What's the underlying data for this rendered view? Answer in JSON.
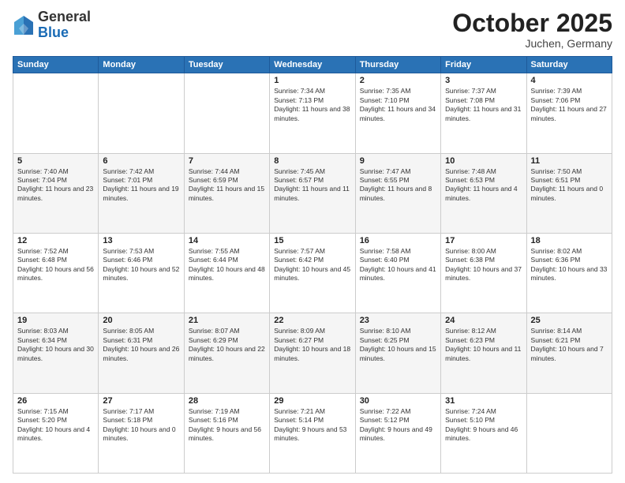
{
  "header": {
    "logo": {
      "general": "General",
      "blue": "Blue"
    },
    "title": "October 2025",
    "location": "Juchen, Germany"
  },
  "calendar": {
    "days_of_week": [
      "Sunday",
      "Monday",
      "Tuesday",
      "Wednesday",
      "Thursday",
      "Friday",
      "Saturday"
    ],
    "weeks": [
      [
        null,
        null,
        null,
        {
          "day": "1",
          "sunrise": "7:34 AM",
          "sunset": "7:13 PM",
          "daylight": "11 hours and 38 minutes."
        },
        {
          "day": "2",
          "sunrise": "7:35 AM",
          "sunset": "7:10 PM",
          "daylight": "11 hours and 34 minutes."
        },
        {
          "day": "3",
          "sunrise": "7:37 AM",
          "sunset": "7:08 PM",
          "daylight": "11 hours and 31 minutes."
        },
        {
          "day": "4",
          "sunrise": "7:39 AM",
          "sunset": "7:06 PM",
          "daylight": "11 hours and 27 minutes."
        }
      ],
      [
        {
          "day": "5",
          "sunrise": "7:40 AM",
          "sunset": "7:04 PM",
          "daylight": "11 hours and 23 minutes."
        },
        {
          "day": "6",
          "sunrise": "7:42 AM",
          "sunset": "7:01 PM",
          "daylight": "11 hours and 19 minutes."
        },
        {
          "day": "7",
          "sunrise": "7:44 AM",
          "sunset": "6:59 PM",
          "daylight": "11 hours and 15 minutes."
        },
        {
          "day": "8",
          "sunrise": "7:45 AM",
          "sunset": "6:57 PM",
          "daylight": "11 hours and 11 minutes."
        },
        {
          "day": "9",
          "sunrise": "7:47 AM",
          "sunset": "6:55 PM",
          "daylight": "11 hours and 8 minutes."
        },
        {
          "day": "10",
          "sunrise": "7:48 AM",
          "sunset": "6:53 PM",
          "daylight": "11 hours and 4 minutes."
        },
        {
          "day": "11",
          "sunrise": "7:50 AM",
          "sunset": "6:51 PM",
          "daylight": "11 hours and 0 minutes."
        }
      ],
      [
        {
          "day": "12",
          "sunrise": "7:52 AM",
          "sunset": "6:48 PM",
          "daylight": "10 hours and 56 minutes."
        },
        {
          "day": "13",
          "sunrise": "7:53 AM",
          "sunset": "6:46 PM",
          "daylight": "10 hours and 52 minutes."
        },
        {
          "day": "14",
          "sunrise": "7:55 AM",
          "sunset": "6:44 PM",
          "daylight": "10 hours and 48 minutes."
        },
        {
          "day": "15",
          "sunrise": "7:57 AM",
          "sunset": "6:42 PM",
          "daylight": "10 hours and 45 minutes."
        },
        {
          "day": "16",
          "sunrise": "7:58 AM",
          "sunset": "6:40 PM",
          "daylight": "10 hours and 41 minutes."
        },
        {
          "day": "17",
          "sunrise": "8:00 AM",
          "sunset": "6:38 PM",
          "daylight": "10 hours and 37 minutes."
        },
        {
          "day": "18",
          "sunrise": "8:02 AM",
          "sunset": "6:36 PM",
          "daylight": "10 hours and 33 minutes."
        }
      ],
      [
        {
          "day": "19",
          "sunrise": "8:03 AM",
          "sunset": "6:34 PM",
          "daylight": "10 hours and 30 minutes."
        },
        {
          "day": "20",
          "sunrise": "8:05 AM",
          "sunset": "6:31 PM",
          "daylight": "10 hours and 26 minutes."
        },
        {
          "day": "21",
          "sunrise": "8:07 AM",
          "sunset": "6:29 PM",
          "daylight": "10 hours and 22 minutes."
        },
        {
          "day": "22",
          "sunrise": "8:09 AM",
          "sunset": "6:27 PM",
          "daylight": "10 hours and 18 minutes."
        },
        {
          "day": "23",
          "sunrise": "8:10 AM",
          "sunset": "6:25 PM",
          "daylight": "10 hours and 15 minutes."
        },
        {
          "day": "24",
          "sunrise": "8:12 AM",
          "sunset": "6:23 PM",
          "daylight": "10 hours and 11 minutes."
        },
        {
          "day": "25",
          "sunrise": "8:14 AM",
          "sunset": "6:21 PM",
          "daylight": "10 hours and 7 minutes."
        }
      ],
      [
        {
          "day": "26",
          "sunrise": "7:15 AM",
          "sunset": "5:20 PM",
          "daylight": "10 hours and 4 minutes."
        },
        {
          "day": "27",
          "sunrise": "7:17 AM",
          "sunset": "5:18 PM",
          "daylight": "10 hours and 0 minutes."
        },
        {
          "day": "28",
          "sunrise": "7:19 AM",
          "sunset": "5:16 PM",
          "daylight": "9 hours and 56 minutes."
        },
        {
          "day": "29",
          "sunrise": "7:21 AM",
          "sunset": "5:14 PM",
          "daylight": "9 hours and 53 minutes."
        },
        {
          "day": "30",
          "sunrise": "7:22 AM",
          "sunset": "5:12 PM",
          "daylight": "9 hours and 49 minutes."
        },
        {
          "day": "31",
          "sunrise": "7:24 AM",
          "sunset": "5:10 PM",
          "daylight": "9 hours and 46 minutes."
        },
        null
      ]
    ]
  }
}
